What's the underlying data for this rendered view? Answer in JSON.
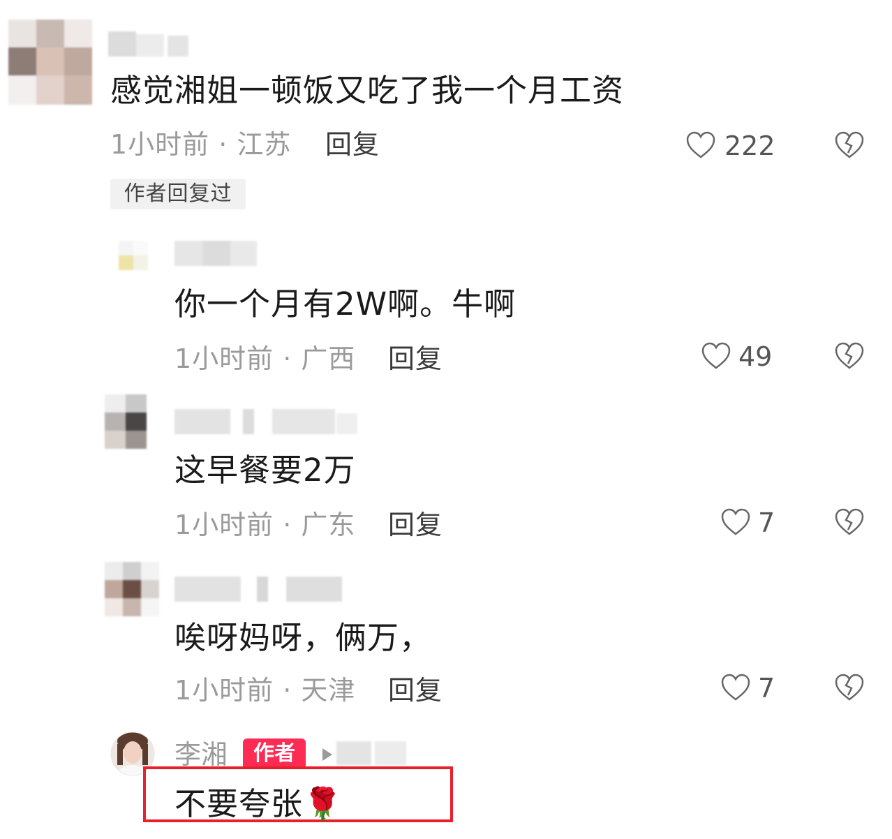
{
  "comments": [
    {
      "text": "感觉湘姐一顿饭又吃了我一个月工资",
      "meta": "1小时前 · 江苏",
      "reply_label": "回复",
      "likes": "222",
      "author_replied_badge": "作者回复过"
    },
    {
      "text": "你一个月有2W啊。牛啊",
      "meta": "1小时前 · 广西",
      "reply_label": "回复",
      "likes": "49"
    },
    {
      "text": "这早餐要2万",
      "meta": "1小时前 · 广东",
      "reply_label": "回复",
      "likes": "7"
    },
    {
      "text": "唉呀妈呀，俩万，",
      "meta": "1小时前 · 天津",
      "reply_label": "回复",
      "likes": "7"
    }
  ],
  "author_reply": {
    "name": "李湘",
    "tag": "作者",
    "text": "不要夸张",
    "emoji": "🌹"
  },
  "icons": {
    "like": "heart-outline-icon",
    "dislike": "broken-heart-icon",
    "play": "play-triangle-icon"
  },
  "colors": {
    "author_tag": "#fe2c55",
    "highlight_border": "#e8202a",
    "meta_text": "#9a9a9a"
  }
}
